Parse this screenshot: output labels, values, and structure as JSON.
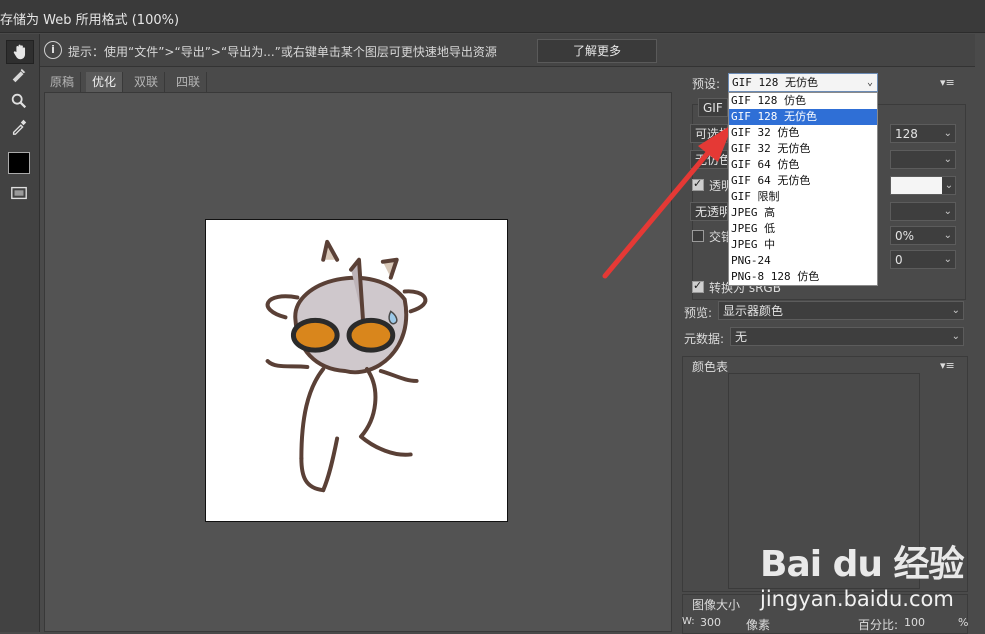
{
  "window": {
    "title": "存储为 Web 所用格式 (100%)"
  },
  "hint": {
    "icon": "info-icon",
    "text": "提示：使用“文件”>“导出”>“导出为...”或右键单击某个图层可更快速地导出资源",
    "learn_more": "了解更多"
  },
  "view_tabs": [
    "原稿",
    "优化",
    "双联",
    "四联"
  ],
  "active_tab": "优化",
  "tools": [
    "hand-icon",
    "slice-select-icon",
    "zoom-icon",
    "eyedropper-icon",
    "preview-icon"
  ],
  "swatch_color": "#000000",
  "preset": {
    "label": "预设:",
    "value": "GIF 128 无仿色",
    "options": [
      "GIF 128 仿色",
      "GIF 128 无仿色",
      "GIF 32 仿色",
      "GIF 32 无仿色",
      "GIF 64 仿色",
      "GIF 64 无仿色",
      "GIF 限制",
      "JPEG 高",
      "JPEG 低",
      "JPEG 中",
      "PNG-24",
      "PNG-8 128 仿色"
    ],
    "selected_index": 1
  },
  "settings": {
    "format": "GIF",
    "reduction": "可选择",
    "dither_algo": "无仿色",
    "colors_value": "128",
    "transparency_label": "透明",
    "matte_dither": "无透明",
    "interlace_label": "交错",
    "dither_pct": "0%",
    "web_snap": "0",
    "convert_srgb": "转换为 sRGB",
    "preview_label": "预览:",
    "preview_value": "显示器颜色",
    "metadata_label": "元数据:",
    "metadata_value": "无"
  },
  "color_table": {
    "title": "颜色表"
  },
  "image_size": {
    "title": "图像大小",
    "w_label": "W:",
    "w_value": "300",
    "unit": "像素",
    "pct_label": "百分比:",
    "pct_value": "100",
    "pct_unit": "%"
  },
  "watermark": {
    "logo": "Bai du 经验",
    "url": "jingyan.baidu.com"
  },
  "colors": {
    "accent": "#2f6fd6",
    "arrow": "#e53935"
  }
}
